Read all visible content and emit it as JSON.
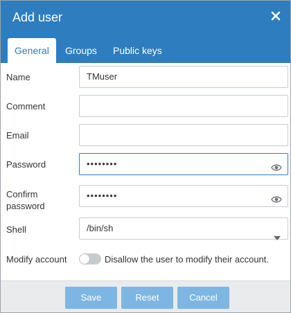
{
  "dialog": {
    "title": "Add user",
    "close_icon": "close-icon"
  },
  "tabs": [
    {
      "label": "General",
      "active": true
    },
    {
      "label": "Groups",
      "active": false
    },
    {
      "label": "Public keys",
      "active": false
    }
  ],
  "form": {
    "name": {
      "label": "Name",
      "value": "TMuser"
    },
    "comment": {
      "label": "Comment",
      "value": ""
    },
    "email": {
      "label": "Email",
      "value": ""
    },
    "password": {
      "label": "Password",
      "value": "••••••••",
      "icon": "eye-icon"
    },
    "confirm_password": {
      "label_line1": "Confirm",
      "label_line2": "password",
      "value": "••••••••",
      "icon": "eye-icon"
    },
    "shell": {
      "label": "Shell",
      "value": "/bin/sh",
      "icon": "chevron-down-icon"
    },
    "modify_account": {
      "label": "Modify account",
      "toggle_text": "Disallow the user to modify their account.",
      "enabled": false
    }
  },
  "footer": {
    "save_label": "Save",
    "reset_label": "Reset",
    "cancel_label": "Cancel"
  },
  "colors": {
    "header": "#2e7dbf",
    "button": "#7eb6e3",
    "footer": "#e9ebed"
  }
}
